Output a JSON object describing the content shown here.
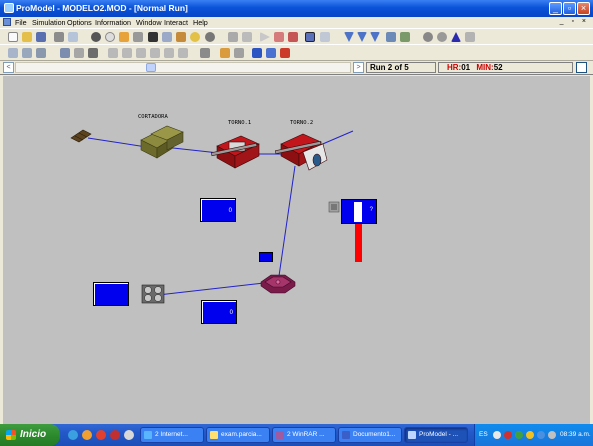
{
  "window": {
    "title": "ProModel - MODELO2.MOD - [Normal Run]"
  },
  "menu": [
    "File",
    "Simulation",
    "Options",
    "Information",
    "Window",
    "Interact",
    "Help"
  ],
  "mdi_controls": "_ ▫ ×",
  "status": {
    "scroll_left": "<",
    "scroll_right": ">",
    "run_counter": "Run 2 of 5",
    "hr_label": "HR:",
    "hr_value": "01",
    "min_label": "MIN:",
    "min_value": "52"
  },
  "locations": {
    "cortadora": "CORTADORA",
    "torno1": "TORNO.1",
    "torno2": "TORNO.2"
  },
  "counters": {
    "top_value": "0",
    "bottom_value": "0",
    "gauge_value": "?"
  },
  "gauge": {
    "level": 0.45,
    "color": "#ff0000"
  },
  "colors": {
    "canvas": "#c0c0c0",
    "counter": "#0000ee",
    "path": "#2222cc",
    "title_bar": "#0a52d9",
    "alert": "#cc0000"
  },
  "taskbar": {
    "start_label": "Inicio",
    "tasks": [
      "2 Internet...",
      "exam.parcia...",
      "2 WinRAR ...",
      "Documento1...",
      "ProModel - ..."
    ],
    "language": "ES",
    "time": "08:39 a.m."
  }
}
